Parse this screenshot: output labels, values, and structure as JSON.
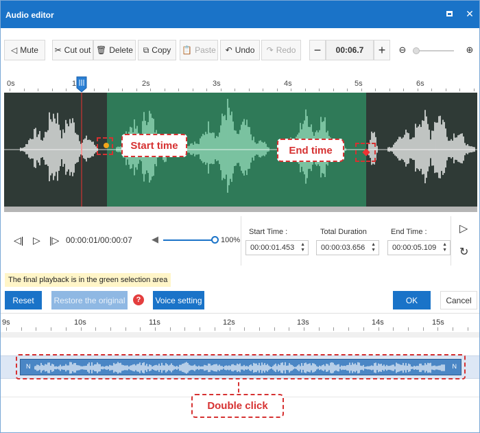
{
  "window": {
    "title": "Audio editor"
  },
  "toolbar": {
    "mute": "Mute",
    "cut_out": "Cut out",
    "delete": "Delete",
    "copy": "Copy",
    "paste": "Paste",
    "undo": "Undo",
    "redo": "Redo",
    "current_time": "00:06.7"
  },
  "ruler_top": [
    "0s",
    "1s",
    "2s",
    "3s",
    "4s",
    "5s",
    "6s"
  ],
  "annotations": {
    "start_time": "Start time",
    "end_time": "End time",
    "double_click": "Double click"
  },
  "player": {
    "timecode": "00:00:01/00:00:07",
    "volume": "100%",
    "volume_level": 1.0
  },
  "time_panel": {
    "start_label": "Start Time :",
    "start_value": "00:00:01.453",
    "duration_label": "Total Duration",
    "duration_value": "00:00:03.656",
    "end_label": "End Time :",
    "end_value": "00:00:05.109"
  },
  "notice": "The final playback is in the green selection area",
  "buttons": {
    "reset": "Reset",
    "restore": "Restore the original",
    "voice_setting": "Voice setting",
    "ok": "OK",
    "cancel": "Cancel"
  },
  "timeline_ruler": [
    "9s",
    "10s",
    "11s",
    "12s",
    "13s",
    "14s",
    "15s"
  ],
  "clip": {
    "left_marker": "N",
    "right_marker": "N"
  },
  "colors": {
    "accent": "#1a73c8",
    "selection": "#2f7a58",
    "annotation": "#d63131",
    "waveform": "#ffffff",
    "waveform_selected": "#9be0c0"
  }
}
